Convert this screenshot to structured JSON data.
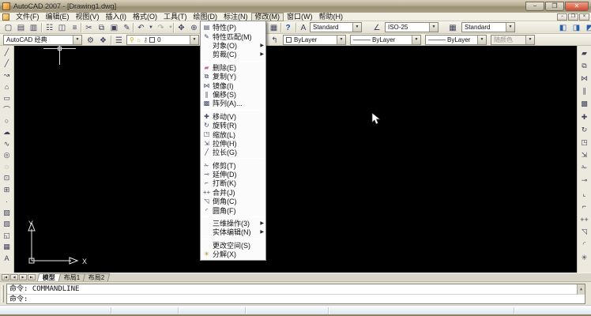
{
  "window": {
    "title": "AutoCAD 2007 - [Drawing1.dwg]",
    "buttons": {
      "minimize": "−",
      "maximize": "❐",
      "close": "✕"
    }
  },
  "menubar": {
    "items": [
      {
        "label": "文件(F)"
      },
      {
        "label": "编辑(E)"
      },
      {
        "label": "视图(V)"
      },
      {
        "label": "插入(I)"
      },
      {
        "label": "格式(O)"
      },
      {
        "label": "工具(T)"
      },
      {
        "label": "绘图(D)"
      },
      {
        "label": "标注(N)"
      },
      {
        "label": "修改(M)"
      },
      {
        "label": "窗口(W)"
      },
      {
        "label": "帮助(H)"
      }
    ],
    "mdi": {
      "minimize": "−",
      "restore": "❒",
      "close": "×"
    }
  },
  "standard_toolbar": {
    "buttons": [
      {
        "name": "qnew",
        "glyph": "▢"
      },
      {
        "name": "open",
        "glyph": "▤"
      },
      {
        "name": "save",
        "glyph": "▥"
      },
      {
        "name": "plot",
        "glyph": "☷"
      },
      {
        "name": "plot-preview",
        "glyph": "◫"
      },
      {
        "name": "publish",
        "glyph": "≡"
      },
      {
        "name": "cut",
        "glyph": "✂"
      },
      {
        "name": "copy",
        "glyph": "⧉"
      },
      {
        "name": "paste",
        "glyph": "▣"
      },
      {
        "name": "match-properties",
        "glyph": "✎"
      },
      {
        "name": "undo",
        "glyph": "↶"
      },
      {
        "name": "redo",
        "glyph": "↷"
      },
      {
        "name": "pan-realtime",
        "glyph": "✥"
      },
      {
        "name": "zoom-realtime",
        "glyph": "⊕"
      },
      {
        "name": "zoom-window",
        "glyph": "◰"
      },
      {
        "name": "quickcalc",
        "glyph": "▦"
      },
      {
        "name": "help",
        "glyph": "?"
      }
    ],
    "drop_arrow": "▼"
  },
  "styles_toolbar": {
    "text_style": {
      "icon": "A",
      "value": "Standard"
    },
    "dim_style": {
      "icon": "∠",
      "value": "ISO-25"
    },
    "table_style": {
      "icon": "▦",
      "value": "Standard"
    }
  },
  "draworder_toolbar": {
    "buttons": [
      {
        "name": "bring-to-front",
        "glyph": "◧"
      },
      {
        "name": "send-to-back",
        "glyph": "◨"
      },
      {
        "name": "bring-above",
        "glyph": "◩"
      },
      {
        "name": "send-under",
        "glyph": "◪"
      }
    ]
  },
  "workspace_toolbar": {
    "value": "AutoCAD 经典",
    "buttons": [
      {
        "name": "workspace-settings",
        "glyph": "⚙"
      },
      {
        "name": "my-workspace",
        "glyph": "❖"
      }
    ]
  },
  "layers_toolbar": {
    "manager_glyph": "☰",
    "bulb_glyph": "⚲",
    "sun_glyph": "☼",
    "lock_glyph": "⚷",
    "current_layer": "0",
    "layer_previous_glyph": "↰"
  },
  "properties_toolbar": {
    "color_value": "ByLayer",
    "linetype_value": "ByLayer",
    "lineweight_value": "ByLayer",
    "plot_style_value": "随颜色",
    "line_glyph": "———"
  },
  "modify_menu": {
    "items": [
      {
        "type": "item",
        "glyph": "▤",
        "label": "特性(P)",
        "arrow": ""
      },
      {
        "type": "item",
        "glyph": "✎",
        "label": "特性匹配(M)",
        "arrow": ""
      },
      {
        "type": "item",
        "glyph": "",
        "label": "对象(O)",
        "arrow": "▶"
      },
      {
        "type": "item",
        "glyph": "",
        "label": "剪裁(C)",
        "arrow": "▶"
      },
      {
        "type": "sep"
      },
      {
        "type": "item",
        "glyph": "▰",
        "label": "删除(E)",
        "arrow": ""
      },
      {
        "type": "item",
        "glyph": "⧉",
        "label": "复制(Y)",
        "arrow": ""
      },
      {
        "type": "item",
        "glyph": "⋈",
        "label": "镜像(I)",
        "arrow": ""
      },
      {
        "type": "item",
        "glyph": "∥",
        "label": "偏移(S)",
        "arrow": ""
      },
      {
        "type": "item",
        "glyph": "▩",
        "label": "阵列(A)...",
        "arrow": ""
      },
      {
        "type": "sep"
      },
      {
        "type": "item",
        "glyph": "✚",
        "label": "移动(V)",
        "arrow": ""
      },
      {
        "type": "item",
        "glyph": "↻",
        "label": "旋转(R)",
        "arrow": ""
      },
      {
        "type": "item",
        "glyph": "◳",
        "label": "缩放(L)",
        "arrow": ""
      },
      {
        "type": "item",
        "glyph": "⇲",
        "label": "拉伸(H)",
        "arrow": ""
      },
      {
        "type": "item",
        "glyph": "╱",
        "label": "拉长(G)",
        "arrow": ""
      },
      {
        "type": "sep"
      },
      {
        "type": "item",
        "glyph": "✁",
        "label": "修剪(T)",
        "arrow": ""
      },
      {
        "type": "item",
        "glyph": "⊸",
        "label": "延伸(D)",
        "arrow": ""
      },
      {
        "type": "item",
        "glyph": "⌐",
        "label": "打断(K)",
        "arrow": ""
      },
      {
        "type": "item",
        "glyph": "++",
        "label": "合并(J)",
        "arrow": ""
      },
      {
        "type": "item",
        "glyph": "◹",
        "label": "倒角(C)",
        "arrow": ""
      },
      {
        "type": "item",
        "glyph": "◜",
        "label": "圆角(F)",
        "arrow": ""
      },
      {
        "type": "sep"
      },
      {
        "type": "item",
        "glyph": "",
        "label": "三维操作(3)",
        "arrow": "▶"
      },
      {
        "type": "item",
        "glyph": "",
        "label": "实体编辑(N)",
        "arrow": "▶"
      },
      {
        "type": "sep"
      },
      {
        "type": "item",
        "glyph": "",
        "label": "更改空间(S)",
        "arrow": ""
      },
      {
        "type": "item",
        "glyph": "✳",
        "label": "分解(X)",
        "arrow": ""
      }
    ]
  },
  "draw_toolbar": {
    "buttons": [
      {
        "name": "line",
        "glyph": "╱"
      },
      {
        "name": "construction-line",
        "glyph": "╱"
      },
      {
        "name": "polyline",
        "glyph": "↝"
      },
      {
        "name": "polygon",
        "glyph": "⌂"
      },
      {
        "name": "rectangle",
        "glyph": "▭"
      },
      {
        "name": "arc",
        "glyph": "⌒"
      },
      {
        "name": "circle",
        "glyph": "○"
      },
      {
        "name": "revision-cloud",
        "glyph": "☁"
      },
      {
        "name": "spline",
        "glyph": "∿"
      },
      {
        "name": "ellipse",
        "glyph": "◎"
      },
      {
        "name": "ellipse-arc",
        "glyph": "◌"
      },
      {
        "name": "insert-block",
        "glyph": "⊡"
      },
      {
        "name": "make-block",
        "glyph": "⊞"
      },
      {
        "name": "point",
        "glyph": "·"
      },
      {
        "name": "hatch",
        "glyph": "▨"
      },
      {
        "name": "gradient",
        "glyph": "▧"
      },
      {
        "name": "region",
        "glyph": "◱"
      },
      {
        "name": "table",
        "glyph": "▦"
      },
      {
        "name": "multiline-text",
        "glyph": "A"
      }
    ]
  },
  "modify_toolbar": {
    "buttons": [
      {
        "name": "erase",
        "glyph": "▰"
      },
      {
        "name": "copy",
        "glyph": "⧉"
      },
      {
        "name": "mirror",
        "glyph": "⋈"
      },
      {
        "name": "offset",
        "glyph": "∥"
      },
      {
        "name": "array",
        "glyph": "▩"
      },
      {
        "name": "move",
        "glyph": "✚"
      },
      {
        "name": "rotate",
        "glyph": "↻"
      },
      {
        "name": "scale",
        "glyph": "◳"
      },
      {
        "name": "stretch",
        "glyph": "⇲"
      },
      {
        "name": "trim",
        "glyph": "✁"
      },
      {
        "name": "extend",
        "glyph": "⊸"
      },
      {
        "name": "break-at-point",
        "glyph": "⌞"
      },
      {
        "name": "break",
        "glyph": "⌐"
      },
      {
        "name": "join",
        "glyph": "++"
      },
      {
        "name": "chamfer",
        "glyph": "◹"
      },
      {
        "name": "fillet",
        "glyph": "◜"
      },
      {
        "name": "explode",
        "glyph": "✳"
      }
    ]
  },
  "canvas": {
    "ucs_x": "X",
    "ucs_y": "Y"
  },
  "layout_tabs": {
    "nav": [
      "|◀",
      "◀",
      "▶",
      "▶|"
    ],
    "tabs": [
      {
        "label": "模型"
      },
      {
        "label": "布局1"
      },
      {
        "label": "布局2"
      }
    ]
  },
  "command_line": {
    "history": "命令: COMMANDLINE",
    "prompt": "命令:"
  },
  "colors": {
    "titlebar_tan": "#b5aa8f",
    "canvas_black": "#000000",
    "close_red": "#cf4a30",
    "layer_yellow": "#d9a900"
  }
}
